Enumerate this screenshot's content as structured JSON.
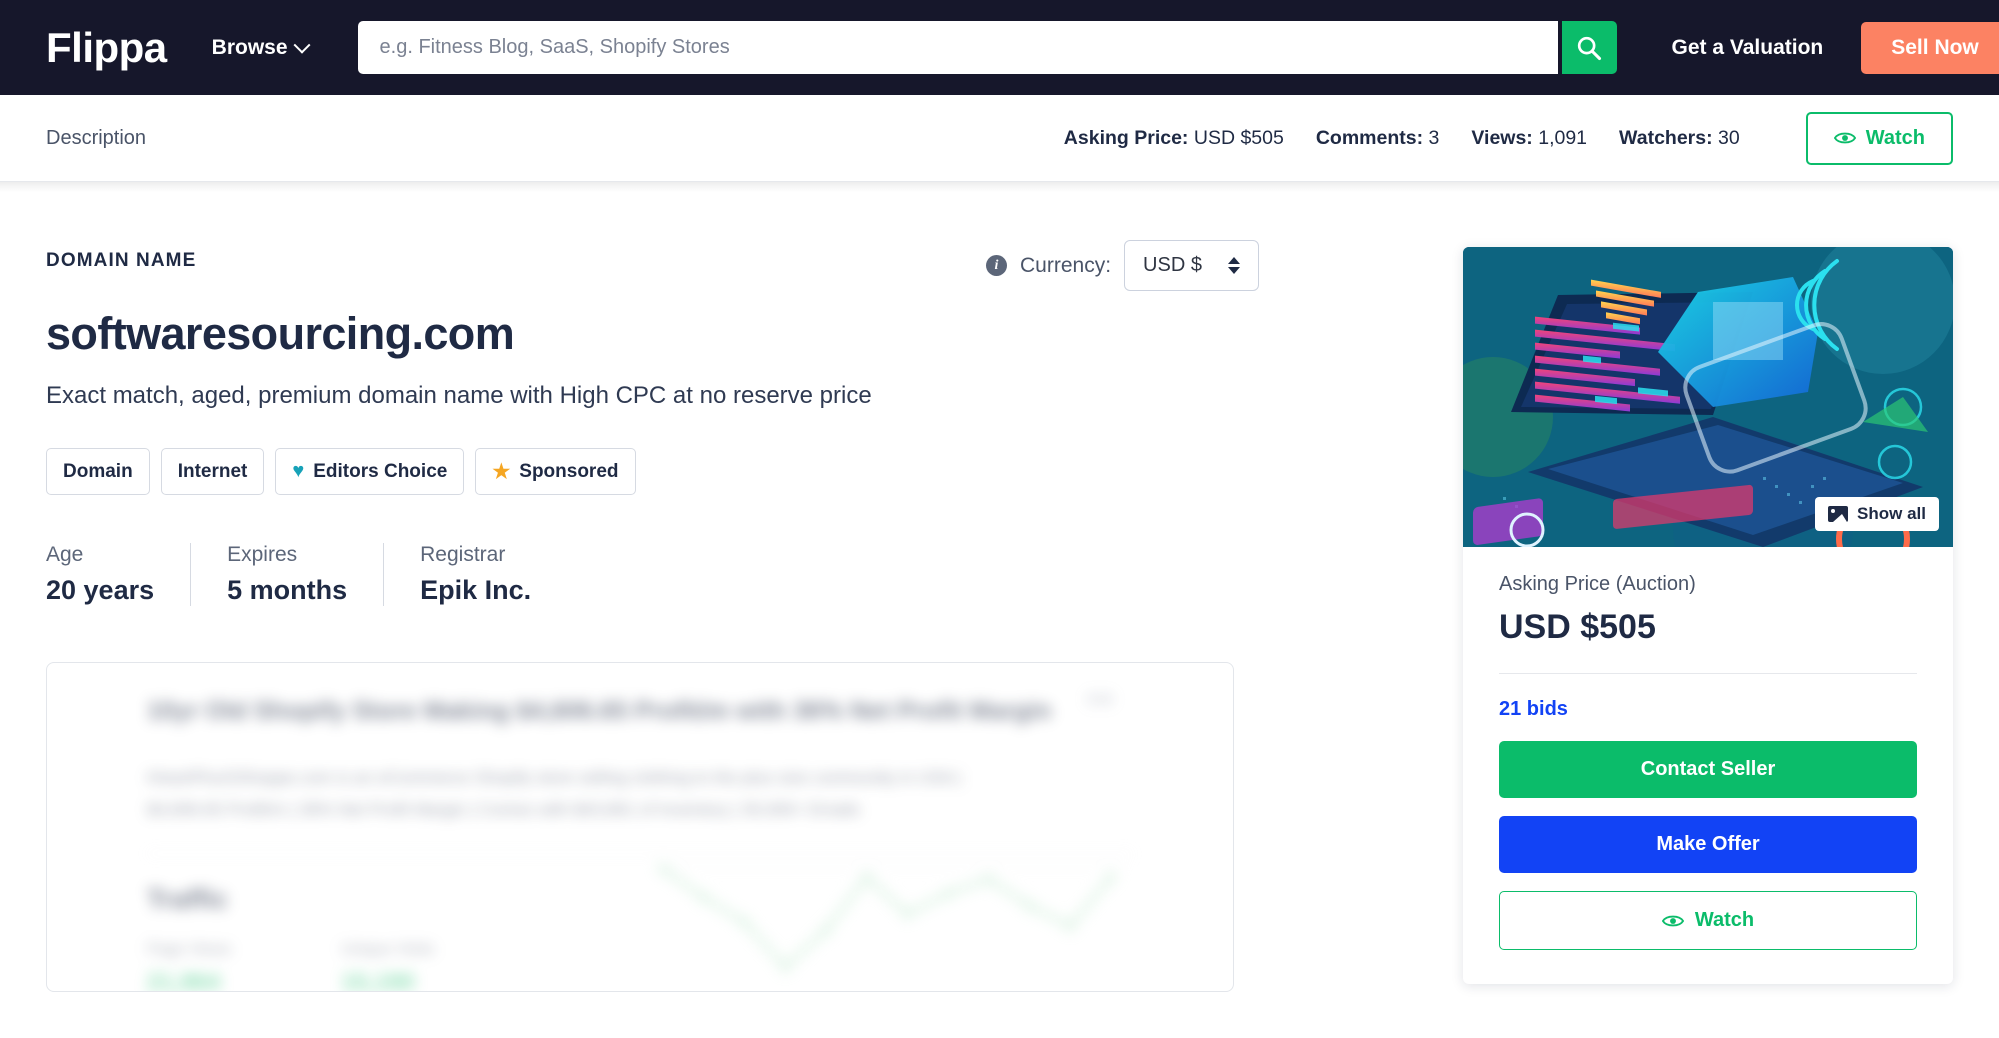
{
  "topnav": {
    "brand": "Flippa",
    "browse": "Browse",
    "search_placeholder": "e.g. Fitness Blog, SaaS, Shopify Stores",
    "search_value": "",
    "search_icon": "search-icon",
    "valuation": "Get a Valuation",
    "sell_now": "Sell Now",
    "accent_green": "#0bbc6a",
    "accent_orange": "#fc8263",
    "bg": "#16172b"
  },
  "statsbar": {
    "tab": "Description",
    "asking_price_label": "Asking Price:",
    "asking_price_value": "USD $505",
    "comments_label": "Comments:",
    "comments_value": "3",
    "views_label": "Views:",
    "views_value": "1,091",
    "watchers_label": "Watchers:",
    "watchers_value": "30",
    "watch_button": "Watch"
  },
  "listing": {
    "eyebrow": "DOMAIN NAME",
    "title": "softwaresourcing.com",
    "subtitle": "Exact match, aged, premium domain name with High CPC at no reserve price",
    "currency_label": "Currency:",
    "currency_value": "USD $",
    "currency_info_icon": "info-icon",
    "tags": [
      {
        "label": "Domain",
        "icon": ""
      },
      {
        "label": "Internet",
        "icon": ""
      },
      {
        "label": "Editors Choice",
        "icon": "heart-icon"
      },
      {
        "label": "Sponsored",
        "icon": "star-icon"
      }
    ],
    "facts": [
      {
        "key": "Age",
        "value": "20 years"
      },
      {
        "key": "Expires",
        "value": "5 months"
      },
      {
        "key": "Registrar",
        "value": "Epik Inc."
      }
    ]
  },
  "preview": {
    "edit": "Edit",
    "title": "10yr Old Shopify Store Making $4,606.65 Profit/m with 36% Net Profit Margin",
    "body": "iHeartPlusSShoppe.com is an eCommerce Shopify store selling clothing to the plus size community in USA | $4,606.65 Profit/m | 36% Net Profit Margin | Comes with $43,861 of Inventory | 35,000+ Emails",
    "traffic_heading": "Traffic",
    "metrics": [
      {
        "label": "Page Views",
        "value": "21,964"
      },
      {
        "label": "Unique Visits",
        "value": "15,190"
      }
    ]
  },
  "sidebar": {
    "hero_alt": "listing-hero-illustration",
    "show_all": "Show all",
    "show_all_icon": "image-icon",
    "asking_price_label": "Asking Price (Auction)",
    "asking_price_value": "USD $505",
    "bids": "21 bids",
    "contact_seller": "Contact Seller",
    "make_offer": "Make Offer",
    "watch": "Watch",
    "contact_color": "#0bbc6a",
    "offer_color": "#1243f5",
    "bids_color": "#1243f5"
  },
  "chart_data": {
    "type": "line",
    "title": "Traffic",
    "x": [
      1,
      2,
      3,
      4,
      5,
      6,
      7,
      8,
      9,
      10,
      11
    ],
    "series": [
      {
        "name": "Page Views",
        "values": [
          62,
          48,
          36,
          14,
          32,
          58,
          40,
          50,
          57,
          44,
          34,
          58
        ]
      }
    ],
    "xlabel": "",
    "ylabel": "",
    "grid": false,
    "legend": "none",
    "color": "#bfe8cd"
  }
}
